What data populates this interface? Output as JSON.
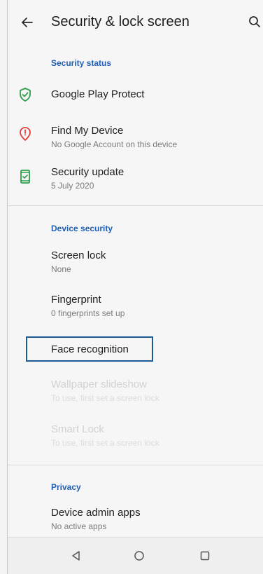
{
  "header": {
    "back_icon": "arrow-left-icon",
    "title": "Security & lock screen",
    "search_icon": "search-icon"
  },
  "sections": [
    {
      "header": "Security status",
      "items": [
        {
          "primary": "Google Play Protect",
          "secondary": "",
          "icon": "shield-check-icon",
          "icon_color": "#2e9e4a",
          "enabled": true
        },
        {
          "primary": "Find My Device",
          "secondary": "No Google Account on this device",
          "icon": "location-alert-icon",
          "icon_color": "#e23b3b",
          "enabled": true
        },
        {
          "primary": "Security update",
          "secondary": "5 July 2020",
          "icon": "phone-check-icon",
          "icon_color": "#2e9e4a",
          "enabled": true
        }
      ]
    },
    {
      "header": "Device security",
      "items": [
        {
          "primary": "Screen lock",
          "secondary": "None",
          "enabled": true
        },
        {
          "primary": "Fingerprint",
          "secondary": "0 fingerprints set up",
          "enabled": true
        },
        {
          "primary": "Face recognition",
          "secondary": "",
          "enabled": true,
          "focused": true
        },
        {
          "primary": "Wallpaper slideshow",
          "secondary": "To use, first set a screen lock",
          "enabled": false
        },
        {
          "primary": "Smart Lock",
          "secondary": "To use, first set a screen lock",
          "enabled": false
        }
      ]
    },
    {
      "header": "Privacy",
      "items": [
        {
          "primary": "Device admin apps",
          "secondary": "No active apps",
          "enabled": true
        }
      ]
    }
  ],
  "navbar": {
    "back_icon": "triangle-back-icon",
    "home_icon": "circle-home-icon",
    "recents_icon": "square-recents-icon"
  },
  "colors": {
    "accent": "#1f5fb5",
    "focus_border": "#1b5b96"
  }
}
